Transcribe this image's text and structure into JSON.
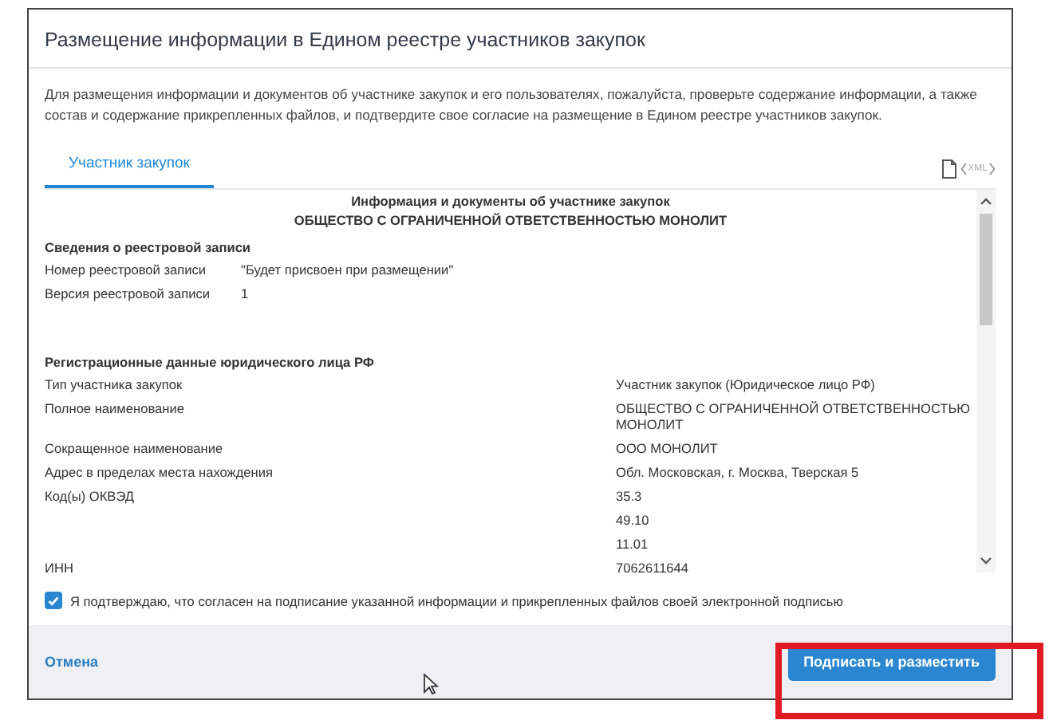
{
  "dialog": {
    "title": "Размещение информации в Едином реестре участников закупок",
    "description": "Для размещения информации и документов об участнике закупок и его пользователях, пожалуйста, проверьте содержание информации, а также состав и содержание прикрепленных файлов, и подтвердите свое согласие на размещение в Едином реестре участников закупок."
  },
  "tabs": [
    {
      "label": "Участник закупок",
      "selected": true
    }
  ],
  "xml_label": "XML",
  "document": {
    "heading": "Информация и документы об участнике закупок",
    "subheading": "ОБЩЕСТВО С ОГРАНИЧЕННОЙ ОТВЕТСТВЕННОСТЬЮ МОНОЛИТ",
    "sections": [
      {
        "title": "Сведения о реестровой записи",
        "rows": [
          {
            "label": "Номер реестровой записи",
            "values": [
              "\"Будет присвоен при размещении\""
            ]
          },
          {
            "label": "Версия реестровой записи",
            "values": [
              "1"
            ]
          }
        ]
      },
      {
        "title": "Регистрационные данные юридического лица РФ",
        "rows": [
          {
            "label": "Тип участника закупок",
            "values": [
              "Участник закупок (Юридическое лицо РФ)"
            ]
          },
          {
            "label": "Полное наименование",
            "values": [
              "ОБЩЕСТВО С ОГРАНИЧЕННОЙ ОТВЕТСТВЕННОСТЬЮ МОНОЛИТ"
            ]
          },
          {
            "label": "Сокращенное наименование",
            "values": [
              "ООО МОНОЛИТ"
            ]
          },
          {
            "label": "Адрес в пределах места нахождения",
            "values": [
              "Обл. Московская, г. Москва, Тверская 5"
            ]
          },
          {
            "label": "Код(ы) ОКВЭД",
            "values": [
              "35.3",
              "49.10",
              "11.01"
            ]
          },
          {
            "label": "ИНН",
            "values": [
              "7062611644"
            ]
          }
        ]
      }
    ]
  },
  "consent": {
    "label": "Я подтверждаю, что согласен на подписание указанной информации и прикрепленных файлов своей электронной подписью",
    "checked": true
  },
  "footer": {
    "cancel": "Отмена",
    "submit": "Подписать и разместить"
  }
}
